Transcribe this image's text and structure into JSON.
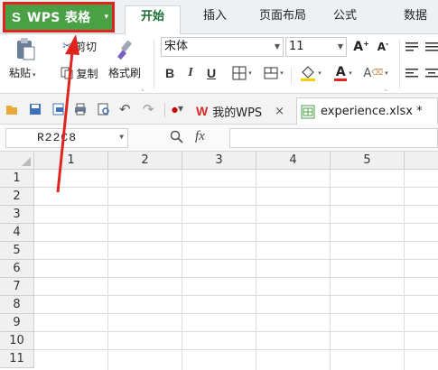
{
  "app_button": {
    "logo": "S",
    "label": "WPS 表格",
    "dropdown": "▾",
    "bg_color": "#4aa145",
    "highlight_color": "#e0231f"
  },
  "menu": {
    "tabs": [
      "开始",
      "插入",
      "页面布局",
      "公式",
      "数据"
    ],
    "active_index": 0
  },
  "ribbon": {
    "cut": "剪切",
    "copy": "复制",
    "paste": "粘贴",
    "format_painter": "格式刷",
    "font_name": "宋体",
    "font_size": "11",
    "bold": "B",
    "italic": "I",
    "underline": "U",
    "grow_font": "A",
    "shrink_font": "A",
    "font_color_letter": "A",
    "font_color": "#e0231f",
    "fill_color": "#f5d000"
  },
  "doc_tabs": {
    "wps_tab": "我的WPS",
    "file_tab": "experience.xlsx *",
    "close_glyph": "×"
  },
  "formula_bar": {
    "cell_ref": "R22C8",
    "zoom_glyph": "🔍",
    "fx": "fx"
  },
  "grid": {
    "columns": [
      "1",
      "2",
      "3",
      "4",
      "5"
    ],
    "rows": [
      "1",
      "2",
      "3",
      "4",
      "5",
      "6",
      "7",
      "8",
      "9",
      "10",
      "11"
    ]
  },
  "icons": {
    "paste": "clipboard-icon",
    "cut": "scissors-icon",
    "copy": "copy-icon",
    "brush": "brush-icon",
    "open": "folder-icon",
    "save": "save-icon",
    "print": "print-icon",
    "preview": "print-preview-icon",
    "undo": "undo-icon",
    "redo": "redo-icon"
  }
}
